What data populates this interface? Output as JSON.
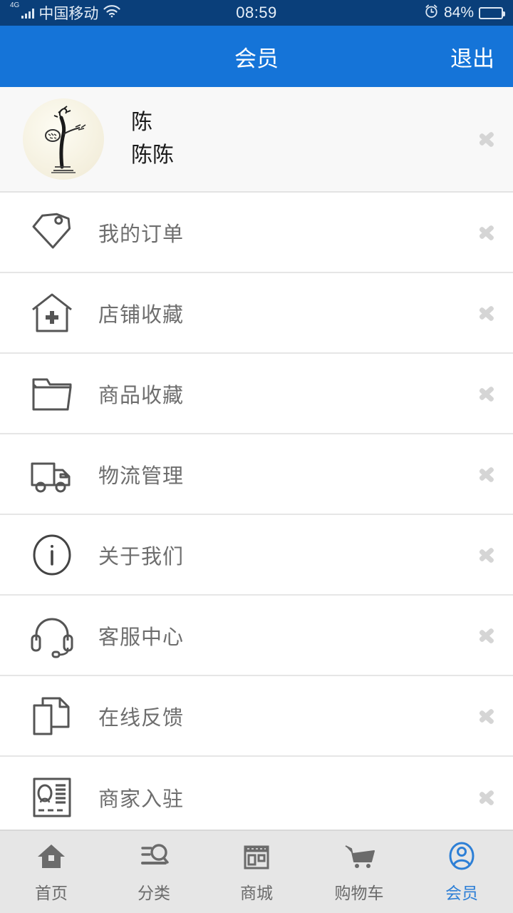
{
  "statusbar": {
    "network_type": "4G",
    "carrier": "中国移动",
    "wifi_icon": "wifi-icon",
    "signal_icon": "signal-bars-icon",
    "time": "08:59",
    "alarm_icon": "alarm-clock-icon",
    "battery_percent": "84%",
    "battery_level": 84,
    "battery_icon": "battery-icon",
    "background_color": "#0a3f7a"
  },
  "header": {
    "title": "会员",
    "action_label": "退出",
    "background_color": "#1574d8"
  },
  "profile": {
    "avatar_icon": "avatar",
    "name_line1": "陈",
    "name_line2": "陈陈",
    "chevron_icon": "chevron-right-icon",
    "background_color": "#f8f8f8"
  },
  "menu": {
    "items": [
      {
        "label": "我的订单",
        "icon": "price-tag-icon",
        "chevron_icon": "chevron-right-icon"
      },
      {
        "label": "店铺收藏",
        "icon": "house-plus-icon",
        "chevron_icon": "chevron-right-icon"
      },
      {
        "label": "商品收藏",
        "icon": "folder-icon",
        "chevron_icon": "chevron-right-icon"
      },
      {
        "label": "物流管理",
        "icon": "truck-icon",
        "chevron_icon": "chevron-right-icon"
      },
      {
        "label": "关于我们",
        "icon": "info-circle-icon",
        "chevron_icon": "chevron-right-icon"
      },
      {
        "label": "客服中心",
        "icon": "headset-icon",
        "chevron_icon": "chevron-right-icon"
      },
      {
        "label": "在线反馈",
        "icon": "documents-icon",
        "chevron_icon": "chevron-right-icon"
      },
      {
        "label": "商家入驻",
        "icon": "id-card-icon",
        "chevron_icon": "chevron-right-icon"
      }
    ],
    "label_color": "#6e6e6e",
    "icon_color": "#555555"
  },
  "tabbar": {
    "background_color": "#e6e6e6",
    "active_color": "#2d7fd6",
    "inactive_color": "#6b6b6b",
    "items": [
      {
        "label": "首页",
        "icon": "home-icon",
        "active": false
      },
      {
        "label": "分类",
        "icon": "category-search-icon",
        "active": false
      },
      {
        "label": "商城",
        "icon": "shop-icon",
        "active": false
      },
      {
        "label": "购物车",
        "icon": "cart-icon",
        "active": false
      },
      {
        "label": "会员",
        "icon": "user-circle-icon",
        "active": true
      }
    ]
  }
}
